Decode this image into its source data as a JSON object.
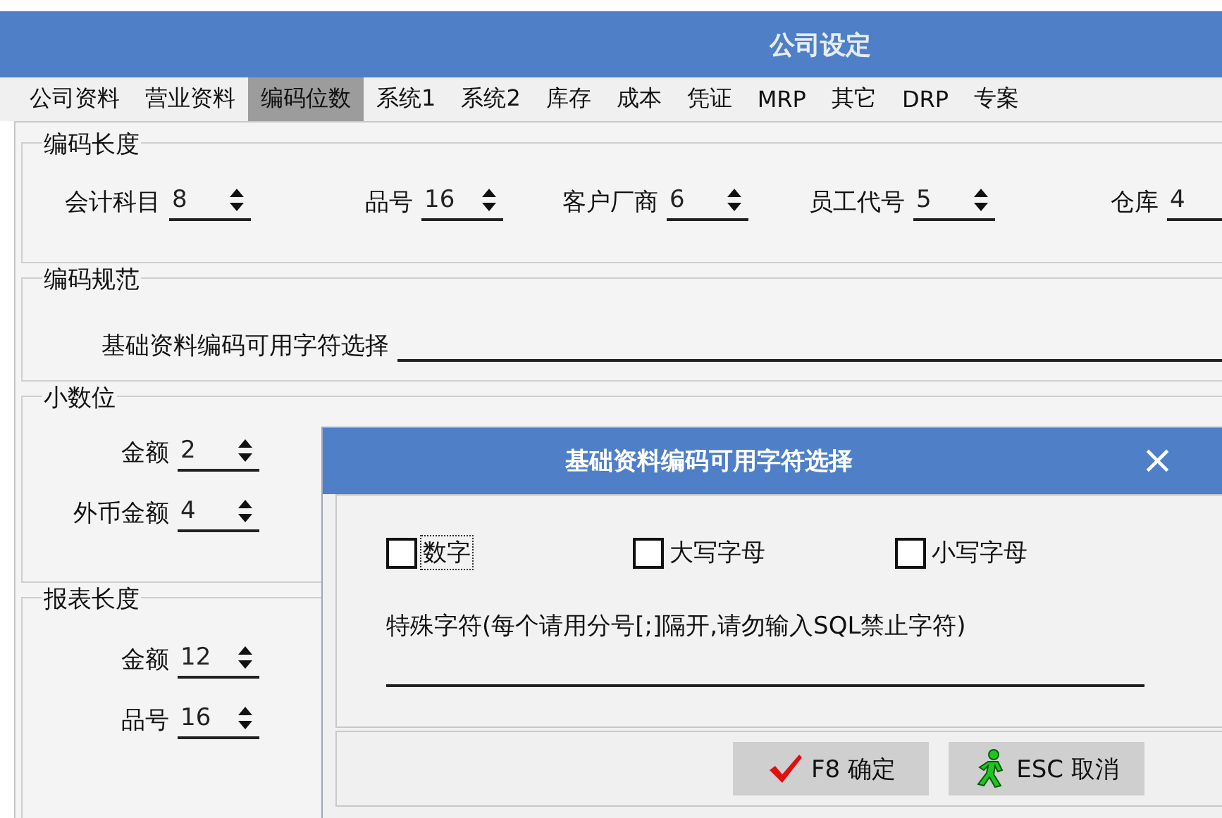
{
  "window": {
    "title": "公司设定"
  },
  "tabs": [
    {
      "label": "公司资料",
      "selected": false
    },
    {
      "label": "营业资料",
      "selected": false
    },
    {
      "label": "编码位数",
      "selected": true
    },
    {
      "label": "系统1",
      "selected": false
    },
    {
      "label": "系统2",
      "selected": false
    },
    {
      "label": "库存",
      "selected": false
    },
    {
      "label": "成本",
      "selected": false
    },
    {
      "label": "凭证",
      "selected": false
    },
    {
      "label": "MRP",
      "selected": false
    },
    {
      "label": "其它",
      "selected": false
    },
    {
      "label": "DRP",
      "selected": false
    },
    {
      "label": "专案",
      "selected": false
    }
  ],
  "code_length": {
    "title": "编码长度",
    "fields": [
      {
        "label": "会计科目",
        "value": "8"
      },
      {
        "label": "品号",
        "value": "16"
      },
      {
        "label": "客户厂商",
        "value": "6"
      },
      {
        "label": "员工代号",
        "value": "5"
      },
      {
        "label": "仓库",
        "value": "4"
      }
    ]
  },
  "code_rules": {
    "title": "编码规范",
    "field_label": "基础资料编码可用字符选择"
  },
  "decimals": {
    "title": "小数位",
    "fields": [
      {
        "label": "金额",
        "value": "2"
      },
      {
        "label": "外币金额",
        "value": "4"
      }
    ]
  },
  "report_length": {
    "title": "报表长度",
    "fields": [
      {
        "label": "金额",
        "value": "12"
      },
      {
        "label": "品号",
        "value": "16"
      }
    ]
  },
  "dialog": {
    "title": "基础资料编码可用字符选择",
    "close": "×",
    "checkboxes": [
      {
        "label": "数字",
        "checked": false,
        "focused": true
      },
      {
        "label": "大写字母",
        "checked": false,
        "focused": false
      },
      {
        "label": "小写字母",
        "checked": false,
        "focused": false
      }
    ],
    "special_label": "特殊字符(每个请用分号[;]隔开,请勿输入SQL禁止字符)",
    "buttons": [
      {
        "label": "F8 确定",
        "kind": "ok"
      },
      {
        "label": "ESC 取消",
        "kind": "cancel"
      }
    ]
  }
}
